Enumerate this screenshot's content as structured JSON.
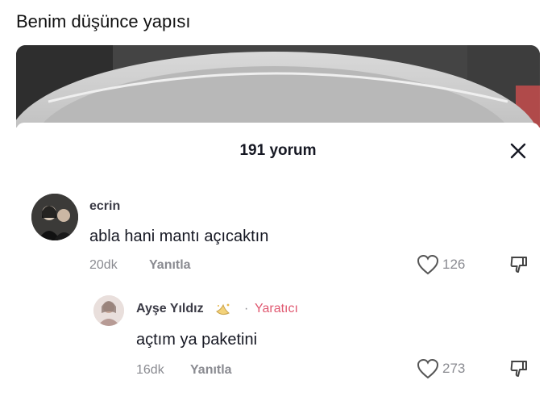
{
  "caption": "Benim düşünce yapısı",
  "sheet": {
    "title": "191 yorum"
  },
  "comments": [
    {
      "username": "ecrin",
      "text": "abla hani mantı açıcaktın",
      "time": "20dk",
      "reply_label": "Yanıtla",
      "likes": "126"
    },
    {
      "username": "Ayşe Yıldız",
      "creator_separator": "·",
      "creator_label": "Yaratıcı",
      "text": "açtım ya paketini",
      "time": "16dk",
      "reply_label": "Yanıtla",
      "likes": "273"
    }
  ],
  "colors": {
    "creator_accent": "#e05870",
    "muted": "#8a8b91",
    "text": "#161823"
  },
  "icons": {
    "close": "close-icon",
    "like": "heart-outline-icon",
    "dislike": "thumbs-down-icon",
    "emoji": "sparkle-emoji-icon"
  }
}
